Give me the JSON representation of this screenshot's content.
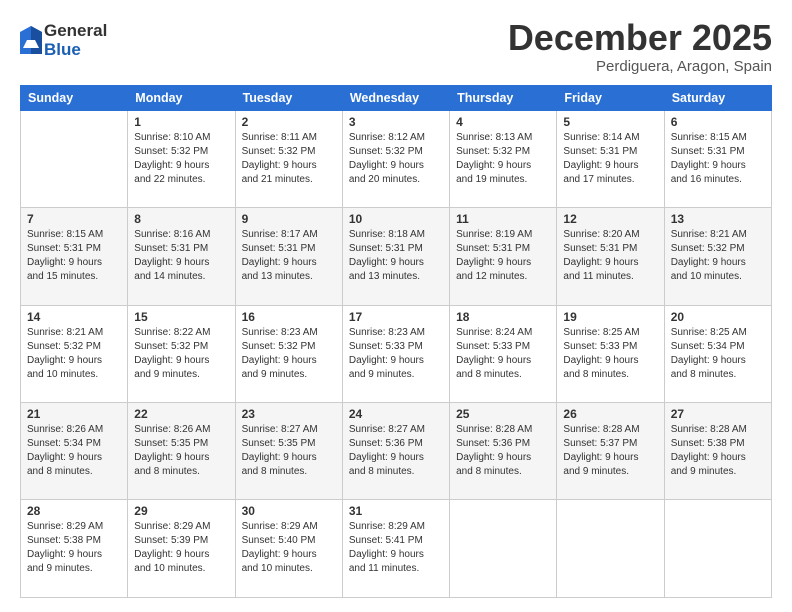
{
  "logo": {
    "general": "General",
    "blue": "Blue"
  },
  "header": {
    "month": "December 2025",
    "location": "Perdiguera, Aragon, Spain"
  },
  "weekdays": [
    "Sunday",
    "Monday",
    "Tuesday",
    "Wednesday",
    "Thursday",
    "Friday",
    "Saturday"
  ],
  "weeks": [
    [
      {
        "day": "",
        "sunrise": "",
        "sunset": "",
        "daylight": ""
      },
      {
        "day": "1",
        "sunrise": "Sunrise: 8:10 AM",
        "sunset": "Sunset: 5:32 PM",
        "daylight": "Daylight: 9 hours and 22 minutes."
      },
      {
        "day": "2",
        "sunrise": "Sunrise: 8:11 AM",
        "sunset": "Sunset: 5:32 PM",
        "daylight": "Daylight: 9 hours and 21 minutes."
      },
      {
        "day": "3",
        "sunrise": "Sunrise: 8:12 AM",
        "sunset": "Sunset: 5:32 PM",
        "daylight": "Daylight: 9 hours and 20 minutes."
      },
      {
        "day": "4",
        "sunrise": "Sunrise: 8:13 AM",
        "sunset": "Sunset: 5:32 PM",
        "daylight": "Daylight: 9 hours and 19 minutes."
      },
      {
        "day": "5",
        "sunrise": "Sunrise: 8:14 AM",
        "sunset": "Sunset: 5:31 PM",
        "daylight": "Daylight: 9 hours and 17 minutes."
      },
      {
        "day": "6",
        "sunrise": "Sunrise: 8:15 AM",
        "sunset": "Sunset: 5:31 PM",
        "daylight": "Daylight: 9 hours and 16 minutes."
      }
    ],
    [
      {
        "day": "7",
        "sunrise": "Sunrise: 8:15 AM",
        "sunset": "Sunset: 5:31 PM",
        "daylight": "Daylight: 9 hours and 15 minutes."
      },
      {
        "day": "8",
        "sunrise": "Sunrise: 8:16 AM",
        "sunset": "Sunset: 5:31 PM",
        "daylight": "Daylight: 9 hours and 14 minutes."
      },
      {
        "day": "9",
        "sunrise": "Sunrise: 8:17 AM",
        "sunset": "Sunset: 5:31 PM",
        "daylight": "Daylight: 9 hours and 13 minutes."
      },
      {
        "day": "10",
        "sunrise": "Sunrise: 8:18 AM",
        "sunset": "Sunset: 5:31 PM",
        "daylight": "Daylight: 9 hours and 13 minutes."
      },
      {
        "day": "11",
        "sunrise": "Sunrise: 8:19 AM",
        "sunset": "Sunset: 5:31 PM",
        "daylight": "Daylight: 9 hours and 12 minutes."
      },
      {
        "day": "12",
        "sunrise": "Sunrise: 8:20 AM",
        "sunset": "Sunset: 5:31 PM",
        "daylight": "Daylight: 9 hours and 11 minutes."
      },
      {
        "day": "13",
        "sunrise": "Sunrise: 8:21 AM",
        "sunset": "Sunset: 5:32 PM",
        "daylight": "Daylight: 9 hours and 10 minutes."
      }
    ],
    [
      {
        "day": "14",
        "sunrise": "Sunrise: 8:21 AM",
        "sunset": "Sunset: 5:32 PM",
        "daylight": "Daylight: 9 hours and 10 minutes."
      },
      {
        "day": "15",
        "sunrise": "Sunrise: 8:22 AM",
        "sunset": "Sunset: 5:32 PM",
        "daylight": "Daylight: 9 hours and 9 minutes."
      },
      {
        "day": "16",
        "sunrise": "Sunrise: 8:23 AM",
        "sunset": "Sunset: 5:32 PM",
        "daylight": "Daylight: 9 hours and 9 minutes."
      },
      {
        "day": "17",
        "sunrise": "Sunrise: 8:23 AM",
        "sunset": "Sunset: 5:33 PM",
        "daylight": "Daylight: 9 hours and 9 minutes."
      },
      {
        "day": "18",
        "sunrise": "Sunrise: 8:24 AM",
        "sunset": "Sunset: 5:33 PM",
        "daylight": "Daylight: 9 hours and 8 minutes."
      },
      {
        "day": "19",
        "sunrise": "Sunrise: 8:25 AM",
        "sunset": "Sunset: 5:33 PM",
        "daylight": "Daylight: 9 hours and 8 minutes."
      },
      {
        "day": "20",
        "sunrise": "Sunrise: 8:25 AM",
        "sunset": "Sunset: 5:34 PM",
        "daylight": "Daylight: 9 hours and 8 minutes."
      }
    ],
    [
      {
        "day": "21",
        "sunrise": "Sunrise: 8:26 AM",
        "sunset": "Sunset: 5:34 PM",
        "daylight": "Daylight: 9 hours and 8 minutes."
      },
      {
        "day": "22",
        "sunrise": "Sunrise: 8:26 AM",
        "sunset": "Sunset: 5:35 PM",
        "daylight": "Daylight: 9 hours and 8 minutes."
      },
      {
        "day": "23",
        "sunrise": "Sunrise: 8:27 AM",
        "sunset": "Sunset: 5:35 PM",
        "daylight": "Daylight: 9 hours and 8 minutes."
      },
      {
        "day": "24",
        "sunrise": "Sunrise: 8:27 AM",
        "sunset": "Sunset: 5:36 PM",
        "daylight": "Daylight: 9 hours and 8 minutes."
      },
      {
        "day": "25",
        "sunrise": "Sunrise: 8:28 AM",
        "sunset": "Sunset: 5:36 PM",
        "daylight": "Daylight: 9 hours and 8 minutes."
      },
      {
        "day": "26",
        "sunrise": "Sunrise: 8:28 AM",
        "sunset": "Sunset: 5:37 PM",
        "daylight": "Daylight: 9 hours and 9 minutes."
      },
      {
        "day": "27",
        "sunrise": "Sunrise: 8:28 AM",
        "sunset": "Sunset: 5:38 PM",
        "daylight": "Daylight: 9 hours and 9 minutes."
      }
    ],
    [
      {
        "day": "28",
        "sunrise": "Sunrise: 8:29 AM",
        "sunset": "Sunset: 5:38 PM",
        "daylight": "Daylight: 9 hours and 9 minutes."
      },
      {
        "day": "29",
        "sunrise": "Sunrise: 8:29 AM",
        "sunset": "Sunset: 5:39 PM",
        "daylight": "Daylight: 9 hours and 10 minutes."
      },
      {
        "day": "30",
        "sunrise": "Sunrise: 8:29 AM",
        "sunset": "Sunset: 5:40 PM",
        "daylight": "Daylight: 9 hours and 10 minutes."
      },
      {
        "day": "31",
        "sunrise": "Sunrise: 8:29 AM",
        "sunset": "Sunset: 5:41 PM",
        "daylight": "Daylight: 9 hours and 11 minutes."
      },
      {
        "day": "",
        "sunrise": "",
        "sunset": "",
        "daylight": ""
      },
      {
        "day": "",
        "sunrise": "",
        "sunset": "",
        "daylight": ""
      },
      {
        "day": "",
        "sunrise": "",
        "sunset": "",
        "daylight": ""
      }
    ]
  ]
}
